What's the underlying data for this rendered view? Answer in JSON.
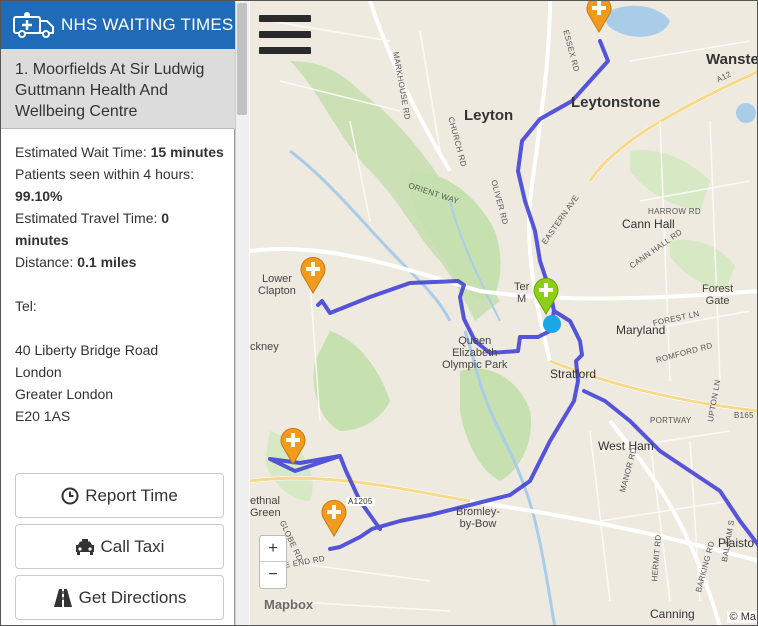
{
  "brand": {
    "title": "NHS WAITING TIMES",
    "icon": "ambulance-icon"
  },
  "venue": {
    "name": "1. Moorfields At Sir Ludwig Guttmann Health And Wellbeing Centre"
  },
  "info": {
    "wait_label": "Estimated Wait Time:",
    "wait_value": "15 minutes",
    "seen_label": "Patients seen within 4 hours:",
    "seen_value": "99.10%",
    "travel_label": "Estimated Travel Time:",
    "travel_value": "0 minutes",
    "distance_label": "Distance:",
    "distance_value": "0.1 miles",
    "tel_label": "Tel:",
    "address": [
      "40 Liberty Bridge Road",
      "London",
      "Greater London",
      "E20 1AS"
    ]
  },
  "buttons": {
    "report": "Report Time",
    "taxi": "Call Taxi",
    "directions": "Get Directions"
  },
  "map": {
    "labels": {
      "leyton": "Leyton",
      "leytonstone": "Leytonstone",
      "wanstead": "Wanste",
      "lower_clapton_1": "Lower",
      "lower_clapton_2": "Clapton",
      "hackney": "ckney",
      "qeop_1": "Queen",
      "qeop_2": "Elizabeth",
      "qeop_3": "Olympic Park",
      "stratford": "Stratford",
      "maryland": "Maryland",
      "forest_gate_1": "Forest",
      "forest_gate_2": "Gate",
      "cann_hall": "Cann Hall",
      "west_ham": "West Ham",
      "bromley_1": "Bromley-",
      "bromley_2": "by-Bow",
      "bethnal_1": "ethnal",
      "bethnal_2": "Green",
      "plaistow": "Plaisto",
      "canning": "Canning",
      "temple_1": "Ter",
      "temple_2": "M"
    },
    "roads": {
      "markhouse": "MARKHOUSE RD",
      "church": "CHURCH RD",
      "oliver": "OLIVER RD",
      "orient": "ORIENT WAY",
      "essex": "ESSEX RD",
      "eastern": "EASTERN AVE",
      "harrow": "HARROW RD",
      "cann_hall_rd": "CANN HALL RD",
      "forest_ln": "FOREST LN",
      "romford": "ROMFORD RD",
      "portway": "PORTWAY",
      "b165": "B165",
      "upton": "UPTON LN",
      "manor": "MANOR RD",
      "hermit": "HERMIT RD",
      "barking": "BARKING RD",
      "balaam": "BALAAM S",
      "a1205": "A1205",
      "globe": "GLOBE RD",
      "e_end": "E END RD",
      "a12": "A12"
    },
    "zoom_in": "+",
    "zoom_out": "−",
    "attribution": "Mapbox",
    "attribution_right": "© Ma",
    "colors": {
      "route": "#3a3ad8",
      "hospital_pin": "#f29a1d",
      "selected_pin": "#8ccf16",
      "user_dot": "#1aa7e8"
    }
  }
}
